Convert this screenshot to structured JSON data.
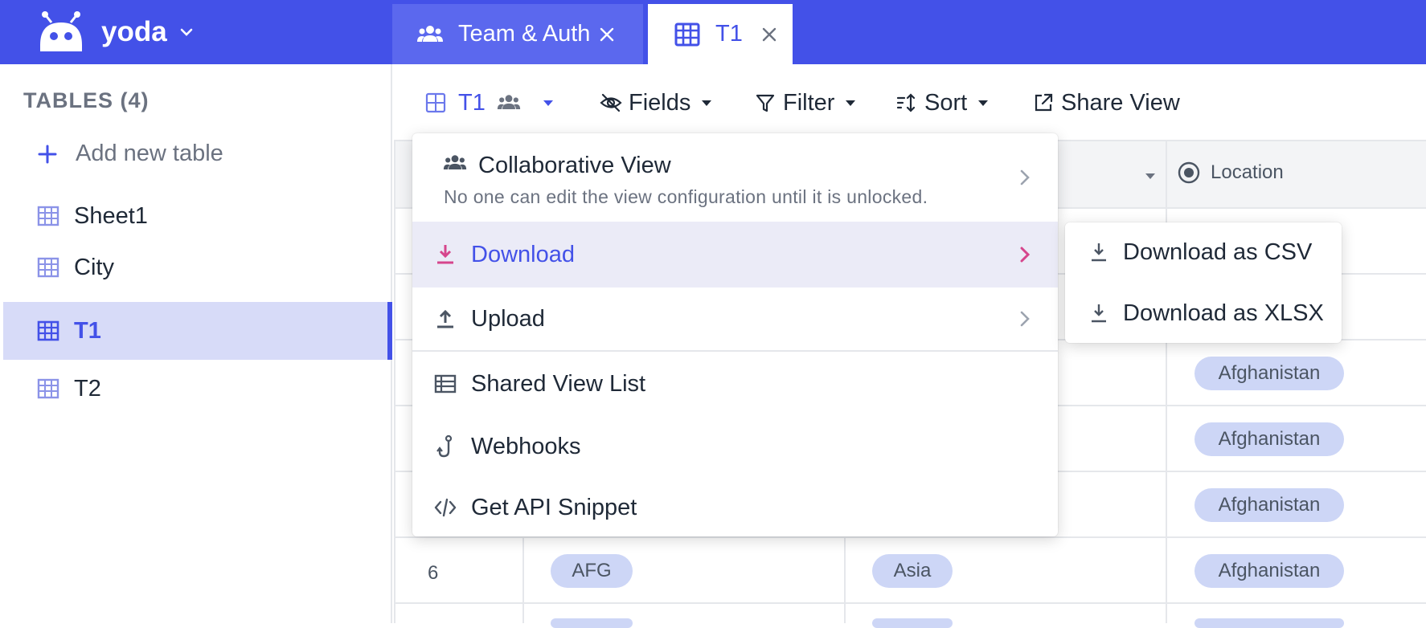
{
  "workspace": {
    "name": "yoda"
  },
  "tabs": [
    {
      "label": "Team & Auth"
    },
    {
      "label": "T1"
    }
  ],
  "sidebar": {
    "heading": "TABLES (4)",
    "add_label": "Add new table",
    "items": [
      {
        "label": "Sheet1"
      },
      {
        "label": "City"
      },
      {
        "label": "T1"
      },
      {
        "label": "T2"
      }
    ]
  },
  "toolbar": {
    "view_name": "T1",
    "fields": "Fields",
    "filter": "Filter",
    "sort": "Sort",
    "share": "Share View"
  },
  "grid": {
    "location_header": "Location",
    "rows": [
      {
        "location": "Afghanistan"
      },
      {
        "location": "Afghanistan"
      },
      {
        "location": "Afghanistan"
      },
      {
        "num": "6",
        "code": "AFG",
        "continent": "Asia",
        "location": "Afghanistan"
      }
    ]
  },
  "menu": {
    "collab_title": "Collaborative View",
    "collab_desc": "No one can edit the view configuration until it is unlocked.",
    "download": "Download",
    "upload": "Upload",
    "shared_view_list": "Shared View List",
    "webhooks": "Webhooks",
    "api_snippet": "Get API Snippet"
  },
  "submenu": {
    "csv": "Download as CSV",
    "xlsx": "Download as XLSX"
  },
  "colors": {
    "brand": "#4351e8",
    "active_bg": "#d7dbf8",
    "chip": "#cdd6f6",
    "download_icon": "#d6458c"
  }
}
